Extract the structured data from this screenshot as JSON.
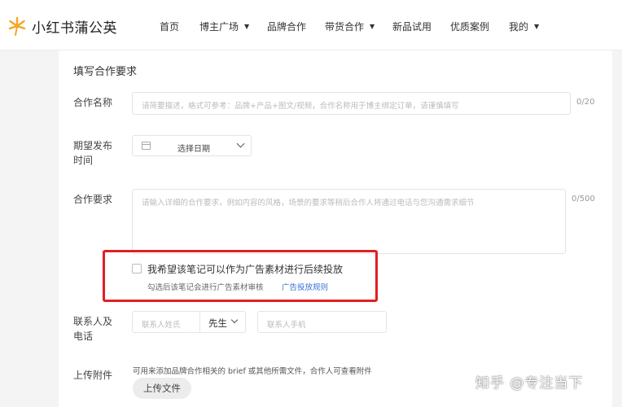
{
  "header": {
    "logo_text": "小红书蒲公英",
    "nav": [
      {
        "label": "首页",
        "has_dropdown": false
      },
      {
        "label": "博主广场",
        "has_dropdown": true
      },
      {
        "label": "品牌合作",
        "has_dropdown": false
      },
      {
        "label": "带货合作",
        "has_dropdown": true
      },
      {
        "label": "新品试用",
        "has_dropdown": false
      },
      {
        "label": "优质案例",
        "has_dropdown": false
      },
      {
        "label": "我的",
        "has_dropdown": true
      }
    ]
  },
  "form": {
    "section_title": "填写合作要求",
    "name": {
      "label": "合作名称",
      "placeholder": "请简要描述，格式可参考：品牌+产品+图文/视频，合作名称用于博主绑定订单，请谨慎填写",
      "counter": "0/20"
    },
    "publish_time": {
      "label_line1": "期望发布",
      "label_line2": "时间",
      "date_placeholder": "选择日期"
    },
    "requirements": {
      "label": "合作要求",
      "placeholder": "请输入详细的合作要求，例如内容的风格，场景的要求等稍后合作人将通过电话与您沟通需求细节",
      "counter": "0/500"
    },
    "ad_material": {
      "checkbox_label": "我希望该笔记可以作为广告素材进行后续投放",
      "hint": "勾选后该笔记会进行广告素材审核",
      "rules_link": "广告投放规则",
      "checked": false
    },
    "contact": {
      "label_line1": "联系人及",
      "label_line2": "电话",
      "name_placeholder": "联系人姓氏",
      "title_selected": "先生",
      "phone_placeholder": "联系人手机"
    },
    "attachment": {
      "label": "上传附件",
      "hint": "可用来添加品牌合作相关的 brief 或其他所需文件，合作人可查看附件",
      "button": "上传文件"
    }
  },
  "watermark": "知乎 @专注当下",
  "colors": {
    "logo_orange": "#f5a623",
    "highlight_red": "#e02020",
    "link_blue": "#3a6fd8"
  }
}
